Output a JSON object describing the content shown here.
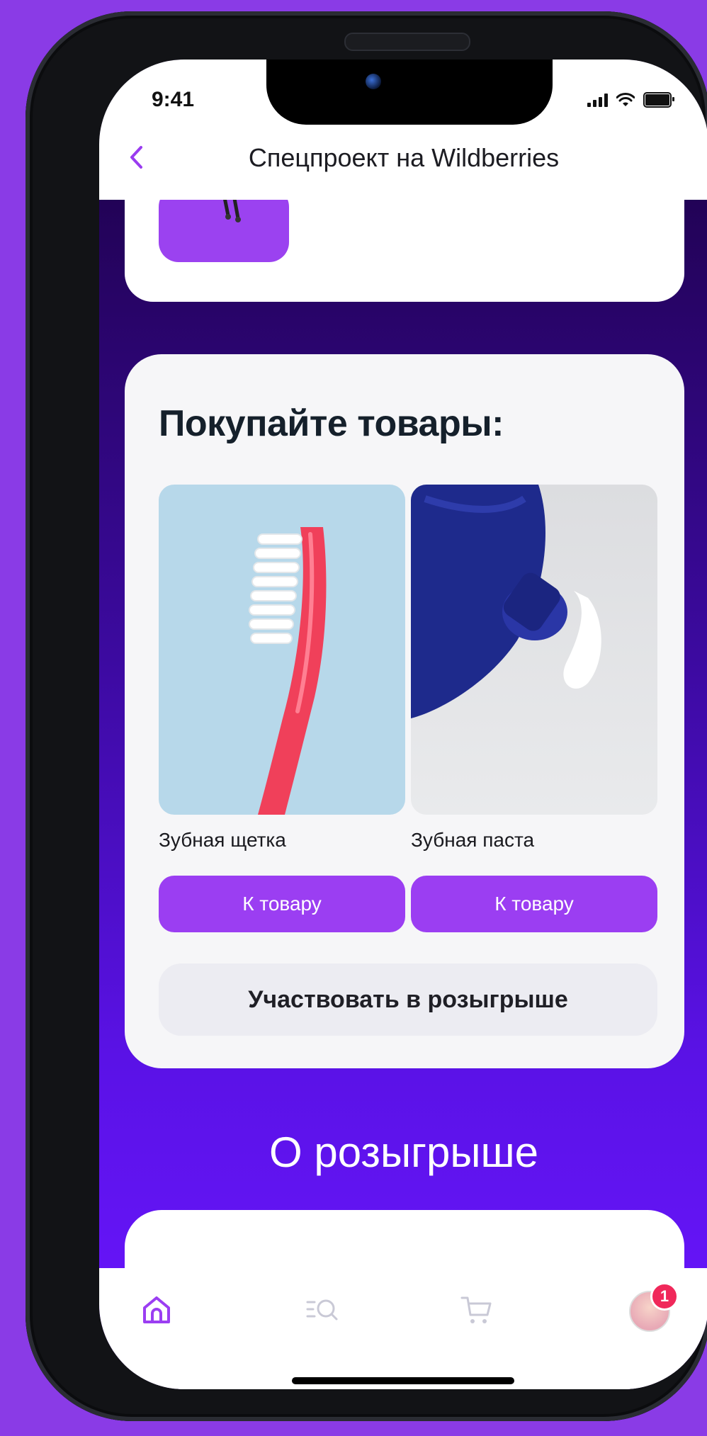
{
  "status": {
    "time": "9:41"
  },
  "nav": {
    "title": "Спецпроект на Wildberries",
    "back_icon": "chevron-left-icon"
  },
  "products_card": {
    "title": "Покупайте товары:",
    "items": [
      {
        "name": "Зубная щетка",
        "button_label": "К товару"
      },
      {
        "name": "Зубная паста",
        "button_label": "К товару"
      }
    ],
    "raffle_button": "Участвовать в розыгрыше"
  },
  "about": {
    "title": "О розыгрыше"
  },
  "tabbar": {
    "items": [
      "home-icon",
      "catalog-search-icon",
      "cart-icon",
      "profile-avatar"
    ],
    "badge_count": "1"
  },
  "colors": {
    "accent": "#9b3ef2",
    "badge": "#f0285a"
  }
}
